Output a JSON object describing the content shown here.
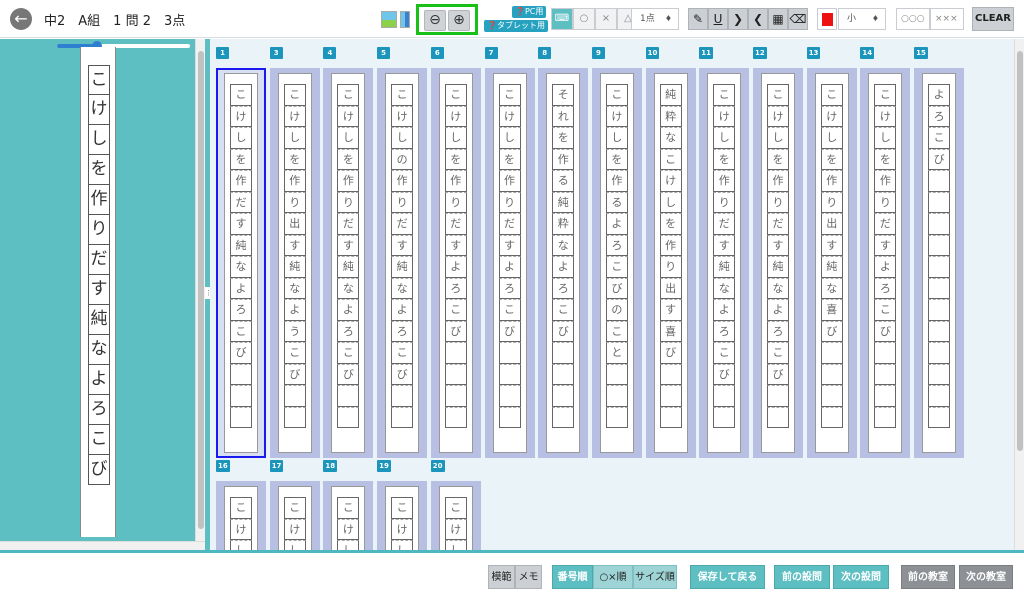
{
  "header": {
    "back_icon": "arrow-left-icon",
    "title": "中2　A組　1 問 2　3点",
    "help_pc": "❓PC用",
    "help_tablet": "❓タブレット用",
    "zoom_out_icon": "zoom-out-icon",
    "zoom_in_icon": "zoom-in-icon",
    "mark_circle": "○",
    "mark_cross": "×",
    "mark_triangle": "△",
    "points_select": "1点",
    "size_select": "小",
    "marks_summary_circle": "○○○",
    "marks_summary_cross": "×××",
    "clear_label": "CLEAR",
    "accent_green": "#18c018",
    "pen_color": "#ee1111"
  },
  "left_panel": {
    "zoom_slider_percent": 30,
    "answer_chars": [
      "こ",
      "け",
      "し",
      "を",
      "作",
      "り",
      "だ",
      "す",
      "純",
      "な",
      "よ",
      "ろ",
      "こ",
      "び"
    ]
  },
  "grid": {
    "selected": "1",
    "cards": [
      {
        "num": "1",
        "chars": [
          "こ",
          "け",
          "し",
          "を",
          "作",
          "だ",
          "す",
          "純",
          "な",
          "よ",
          "ろ",
          "こ",
          "び"
        ]
      },
      {
        "num": "3",
        "chars": [
          "こ",
          "け",
          "し",
          "を",
          "作",
          "り",
          "出",
          "す",
          "純",
          "な",
          "よ",
          "う",
          "こ",
          "び"
        ]
      },
      {
        "num": "4",
        "chars": [
          "こ",
          "け",
          "し",
          "を",
          "作",
          "り",
          "だ",
          "す",
          "純",
          "な",
          "よ",
          "ろ",
          "こ",
          "び"
        ]
      },
      {
        "num": "5",
        "chars": [
          "こ",
          "け",
          "し",
          "の",
          "作",
          "り",
          "だ",
          "す",
          "純",
          "な",
          "よ",
          "ろ",
          "こ",
          "び"
        ]
      },
      {
        "num": "6",
        "chars": [
          "こ",
          "け",
          "し",
          "を",
          "作",
          "り",
          "だ",
          "す",
          "よ",
          "ろ",
          "こ",
          "び"
        ]
      },
      {
        "num": "7",
        "chars": [
          "こ",
          "け",
          "し",
          "を",
          "作",
          "り",
          "だ",
          "す",
          "よ",
          "ろ",
          "こ",
          "び"
        ]
      },
      {
        "num": "8",
        "chars": [
          "そ",
          "れ",
          "を",
          "作",
          "る",
          "純",
          "粋",
          "な",
          "よ",
          "ろ",
          "こ",
          "び"
        ]
      },
      {
        "num": "9",
        "chars": [
          "こ",
          "け",
          "し",
          "を",
          "作",
          "る",
          "よ",
          "ろ",
          "こ",
          "び",
          "の",
          "こ",
          "と"
        ]
      },
      {
        "num": "10",
        "chars": [
          "純",
          "粋",
          "な",
          "こ",
          "け",
          "し",
          "を",
          "作",
          "り",
          "出",
          "す",
          "喜",
          "び"
        ]
      },
      {
        "num": "11",
        "chars": [
          "こ",
          "け",
          "し",
          "を",
          "作",
          "り",
          "だ",
          "す",
          "純",
          "な",
          "よ",
          "ろ",
          "こ",
          "び"
        ]
      },
      {
        "num": "12",
        "chars": [
          "こ",
          "け",
          "し",
          "を",
          "作",
          "り",
          "だ",
          "す",
          "純",
          "な",
          "よ",
          "ろ",
          "こ",
          "び"
        ]
      },
      {
        "num": "13",
        "chars": [
          "こ",
          "け",
          "し",
          "を",
          "作",
          "り",
          "出",
          "す",
          "純",
          "な",
          "喜",
          "び"
        ]
      },
      {
        "num": "14",
        "chars": [
          "こ",
          "け",
          "し",
          "を",
          "作",
          "り",
          "だ",
          "す",
          "よ",
          "ろ",
          "こ",
          "び"
        ]
      },
      {
        "num": "15",
        "chars": [
          "よ",
          "ろ",
          "こ",
          "び"
        ]
      }
    ],
    "cards_row2": [
      {
        "num": "16",
        "chars": [
          "こ",
          "け",
          "し"
        ]
      },
      {
        "num": "17",
        "chars": [
          "こ",
          "け",
          "し"
        ]
      },
      {
        "num": "18",
        "chars": [
          "こ",
          "け",
          "し"
        ]
      },
      {
        "num": "19",
        "chars": [
          "こ",
          "け",
          "し"
        ]
      },
      {
        "num": "20",
        "chars": [
          "こ",
          "け",
          "し"
        ]
      }
    ]
  },
  "footer": {
    "model_answer": "模範",
    "memo": "メモ",
    "sort_number": "番号順",
    "sort_mark": "○×順",
    "sort_size": "サイズ順",
    "save_back": "保存して戻る",
    "prev_question": "前の設問",
    "next_question": "次の設問",
    "prev_class": "前の教室",
    "next_class": "次の教室"
  }
}
